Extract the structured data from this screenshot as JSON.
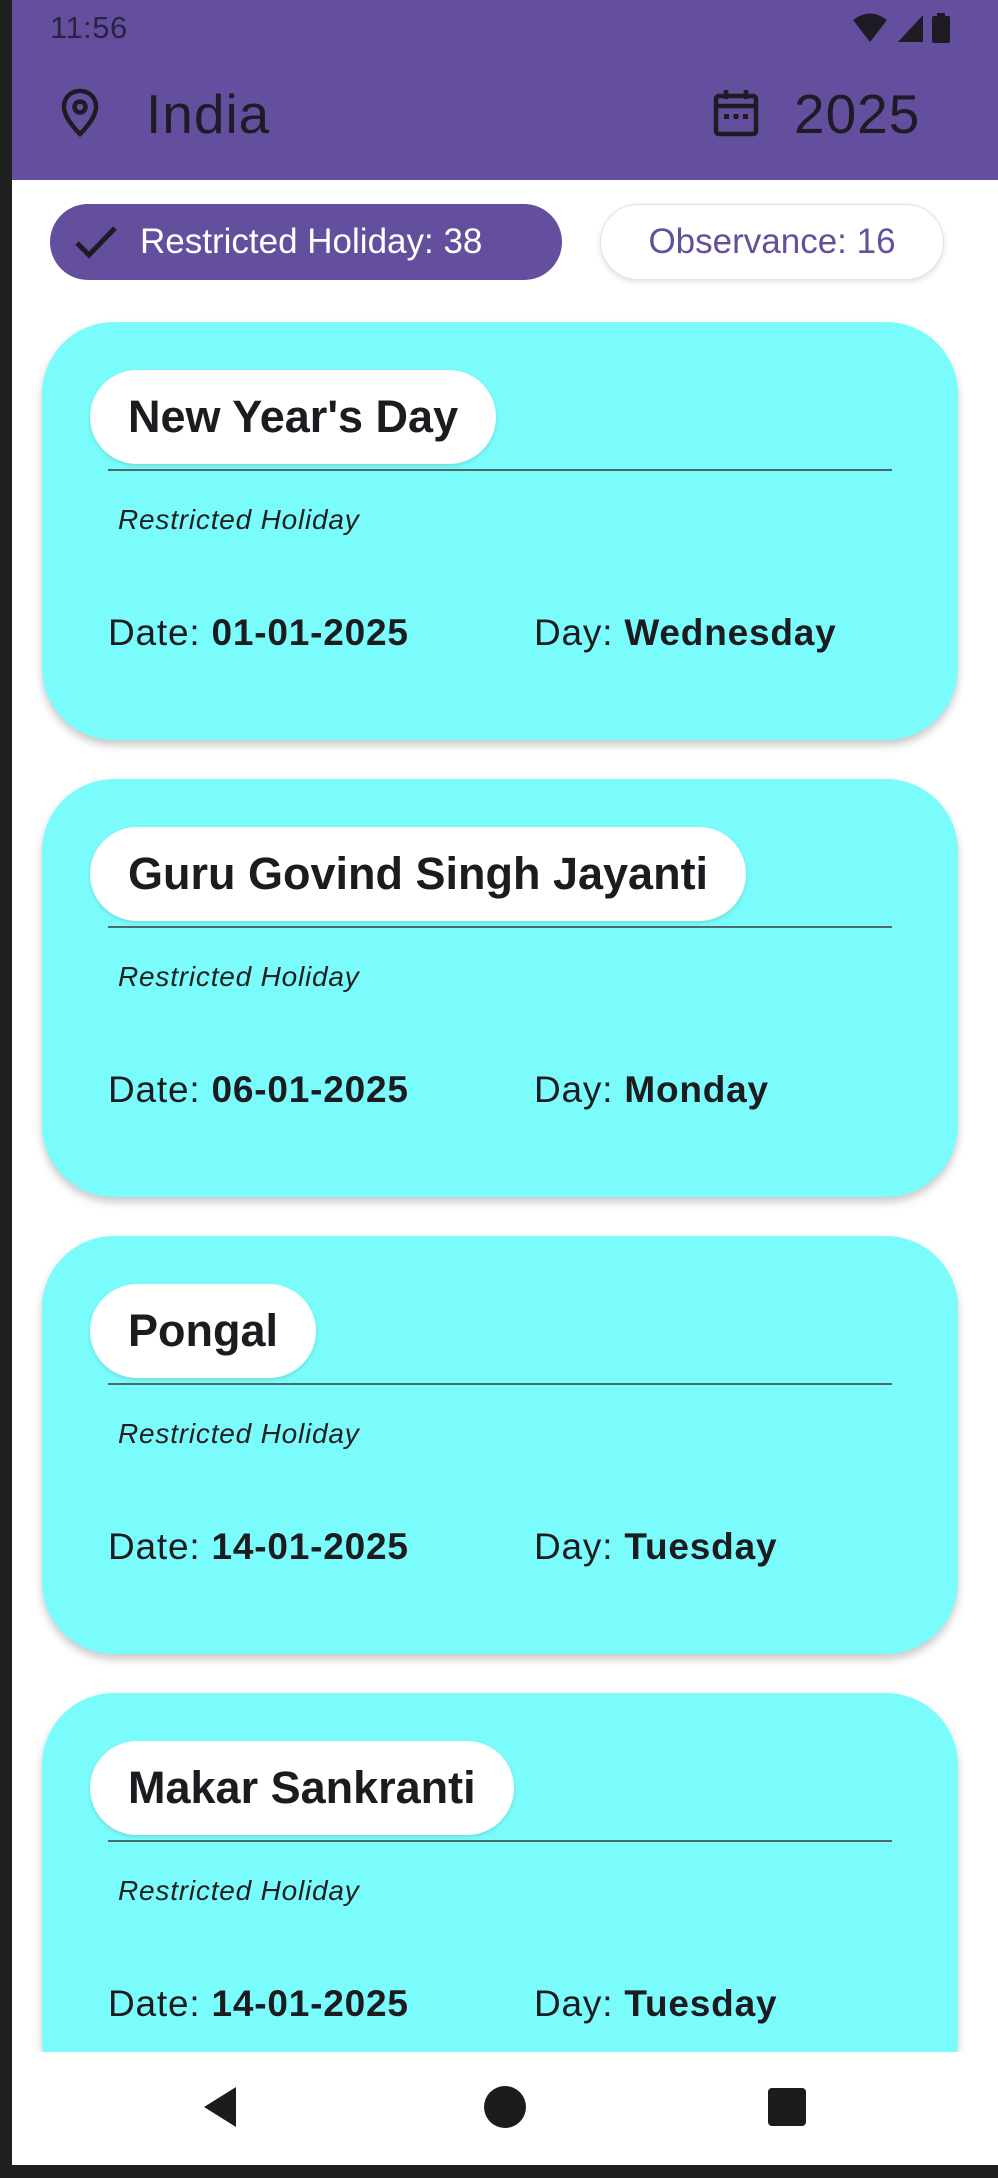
{
  "status_bar": {
    "time": "11:56"
  },
  "header": {
    "country": "India",
    "year": "2025",
    "location_icon": "location-pin-icon",
    "calendar_icon": "calendar-icon",
    "color": "#644f9e"
  },
  "filters": {
    "restricted": {
      "label": "Restricted Holiday: 38",
      "selected": true
    },
    "observance": {
      "label": "Observance: 16",
      "selected": false
    }
  },
  "holidays": [
    {
      "name": "New Year's Day",
      "type": "Restricted Holiday",
      "date_label": "Date: ",
      "date": "01-01-2025",
      "day_label": "Day: ",
      "day": "Wednesday"
    },
    {
      "name": "Guru Govind Singh Jayanti",
      "type": "Restricted Holiday",
      "date_label": "Date: ",
      "date": "06-01-2025",
      "day_label": "Day: ",
      "day": "Monday"
    },
    {
      "name": "Pongal",
      "type": "Restricted Holiday",
      "date_label": "Date: ",
      "date": "14-01-2025",
      "day_label": "Day: ",
      "day": "Tuesday"
    },
    {
      "name": "Makar Sankranti",
      "type": "Restricted Holiday",
      "date_label": "Date: ",
      "date": "14-01-2025",
      "day_label": "Day: ",
      "day": "Tuesday"
    }
  ],
  "colors": {
    "card": "#7afcfc",
    "accent": "#644f9e"
  }
}
